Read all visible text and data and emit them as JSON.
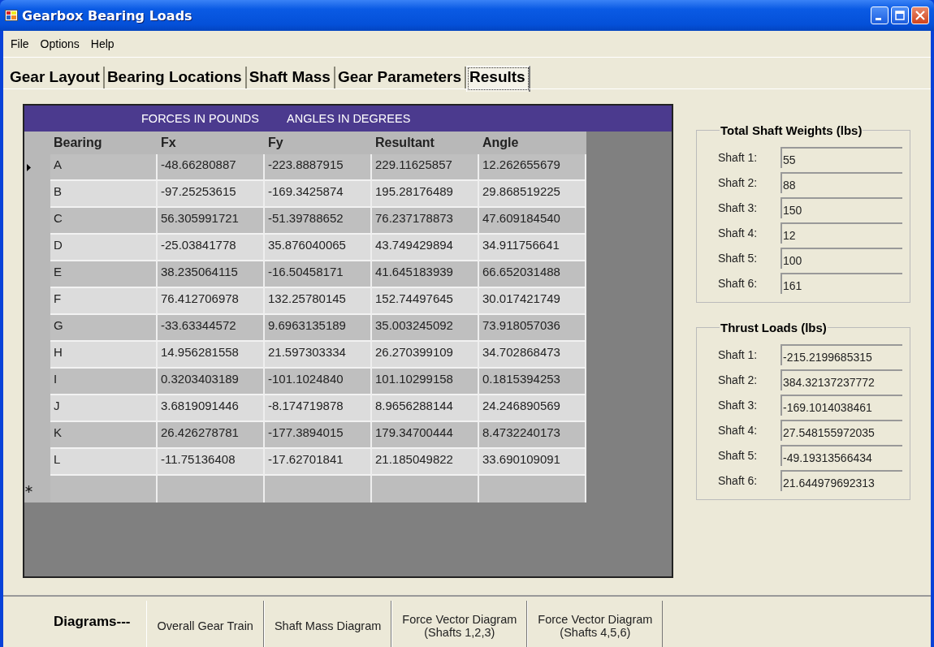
{
  "window": {
    "title": "Gearbox Bearing Loads"
  },
  "menu": [
    "File",
    "Options",
    "Help"
  ],
  "tabs": [
    {
      "label": "Gear Layout",
      "selected": false
    },
    {
      "label": "Bearing Locations",
      "selected": false
    },
    {
      "label": "Shaft Mass",
      "selected": false
    },
    {
      "label": "Gear Parameters",
      "selected": false
    },
    {
      "label": "Results",
      "selected": true
    }
  ],
  "table": {
    "caption": [
      "FORCES IN POUNDS",
      "ANGLES IN DEGREES"
    ],
    "columns": [
      "Bearing",
      "Fx",
      "Fy",
      "Resultant",
      "Angle"
    ],
    "rows": [
      {
        "selected": true,
        "cells": [
          "A",
          "-48.66280887",
          "-223.8887915",
          "229.11625857",
          "12.262655679"
        ]
      },
      {
        "selected": false,
        "cells": [
          "B",
          "-97.25253615",
          "-169.3425874",
          "195.28176489",
          "29.868519225"
        ]
      },
      {
        "selected": false,
        "cells": [
          "C",
          "56.305991721",
          "-51.39788652",
          "76.237178873",
          "47.609184540"
        ]
      },
      {
        "selected": false,
        "cells": [
          "D",
          "-25.03841778",
          "35.876040065",
          "43.749429894",
          "34.911756641"
        ]
      },
      {
        "selected": false,
        "cells": [
          "E",
          "38.235064115",
          "-16.50458171",
          "41.645183939",
          "66.652031488"
        ]
      },
      {
        "selected": false,
        "cells": [
          "F",
          "76.412706978",
          "132.25780145",
          "152.74497645",
          "30.017421749"
        ]
      },
      {
        "selected": false,
        "cells": [
          "G",
          "-33.63344572",
          "9.6963135189",
          "35.003245092",
          "73.918057036"
        ]
      },
      {
        "selected": false,
        "cells": [
          "H",
          "14.956281558",
          "21.597303334",
          "26.270399109",
          "34.702868473"
        ]
      },
      {
        "selected": false,
        "cells": [
          "I",
          "0.3203403189",
          "-101.1024840",
          "101.10299158",
          "0.1815394253"
        ]
      },
      {
        "selected": false,
        "cells": [
          "J",
          "3.6819091446",
          "-8.174719878",
          "8.9656288144",
          "24.246890569"
        ]
      },
      {
        "selected": false,
        "cells": [
          "K",
          "26.426278781",
          "-177.3894015",
          "179.34700444",
          "8.4732240173"
        ]
      },
      {
        "selected": false,
        "cells": [
          "L",
          "-11.75136408",
          "-17.62701841",
          "21.185049822",
          "33.690109091"
        ]
      }
    ],
    "new_row": true
  },
  "groups": [
    {
      "title": "Total Shaft Weights (lbs)",
      "fields": [
        {
          "label": "Shaft 1:",
          "value": "55"
        },
        {
          "label": "Shaft 2:",
          "value": "88"
        },
        {
          "label": "Shaft 3:",
          "value": "150"
        },
        {
          "label": "Shaft 4:",
          "value": "12"
        },
        {
          "label": "Shaft 5:",
          "value": "100"
        },
        {
          "label": "Shaft 6:",
          "value": "161"
        }
      ]
    },
    {
      "title": "Thrust Loads (lbs)",
      "fields": [
        {
          "label": "Shaft 1:",
          "value": "-215.2199685315"
        },
        {
          "label": "Shaft 2:",
          "value": "384.32137237772"
        },
        {
          "label": "Shaft 3:",
          "value": "-169.1014038461"
        },
        {
          "label": "Shaft 4:",
          "value": "27.548155972035"
        },
        {
          "label": "Shaft 5:",
          "value": "-49.19313566434"
        },
        {
          "label": "Shaft 6:",
          "value": "21.644979692313"
        }
      ]
    }
  ],
  "diagrams": {
    "label": "Diagrams---",
    "buttons": [
      "Overall Gear Train",
      "Shaft Mass Diagram",
      "Force Vector Diagram\n(Shafts 1,2,3)",
      "Force Vector Diagram\n(Shafts 4,5,6)"
    ]
  }
}
